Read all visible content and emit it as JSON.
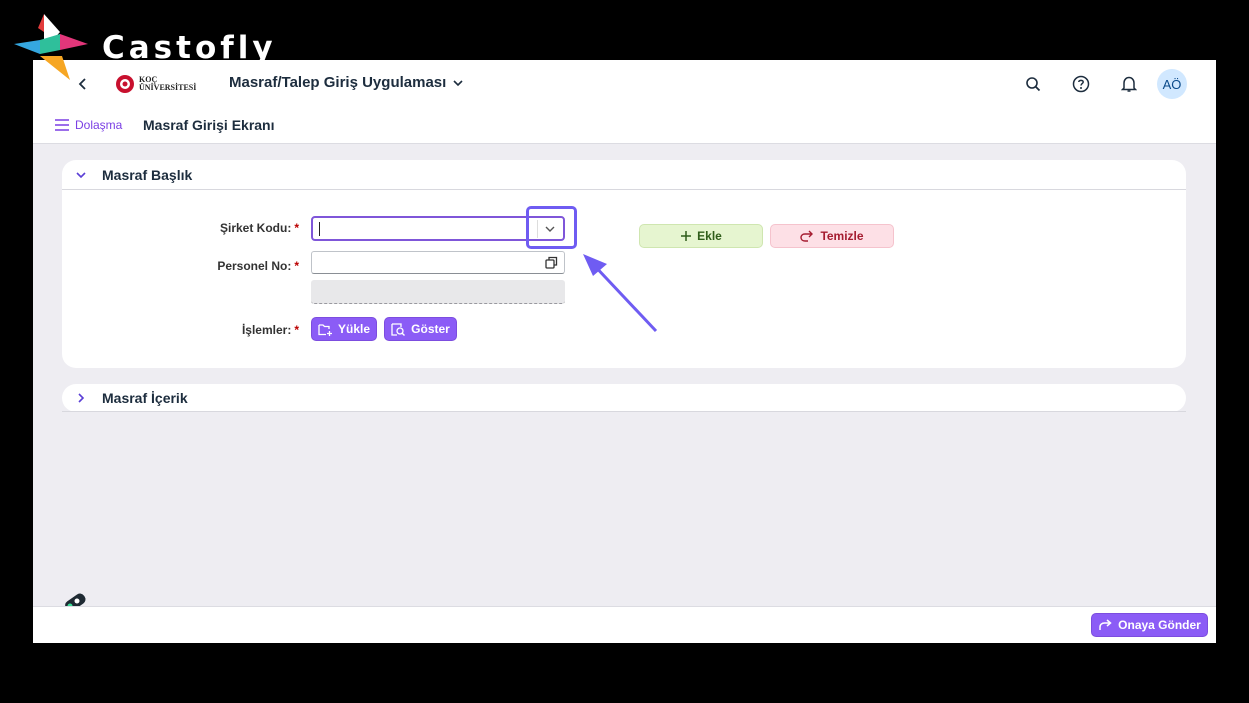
{
  "watermark": {
    "brand": "Castofly"
  },
  "shell": {
    "org_logo_line1": "KOÇ",
    "org_logo_line2": "ÜNİVERSİTESİ",
    "app_title": "Masraf/Talep Giriş Uygulaması",
    "avatar_initials": "AÖ"
  },
  "subheader": {
    "nav_label": "Dolaşma",
    "page_title": "Masraf Girişi Ekranı"
  },
  "header_panel": {
    "title": "Masraf Başlık",
    "company_code_label": "Şirket Kodu:",
    "company_code_value": "",
    "personnel_label": "Personel No:",
    "personnel_value": "",
    "operations_label": "İşlemler:",
    "required_mark": "*",
    "upload_button": "Yükle",
    "show_button": "Göster",
    "add_button": "Ekle",
    "clear_button": "Temizle"
  },
  "content_panel": {
    "title": "Masraf İçerik"
  },
  "footer": {
    "submit_button": "Onaya Gönder"
  },
  "colors": {
    "accent": "#8b5cf6",
    "highlight": "#6f5cf2",
    "add_bg": "#e6f5d0",
    "clear_bg": "#fde0e6"
  }
}
